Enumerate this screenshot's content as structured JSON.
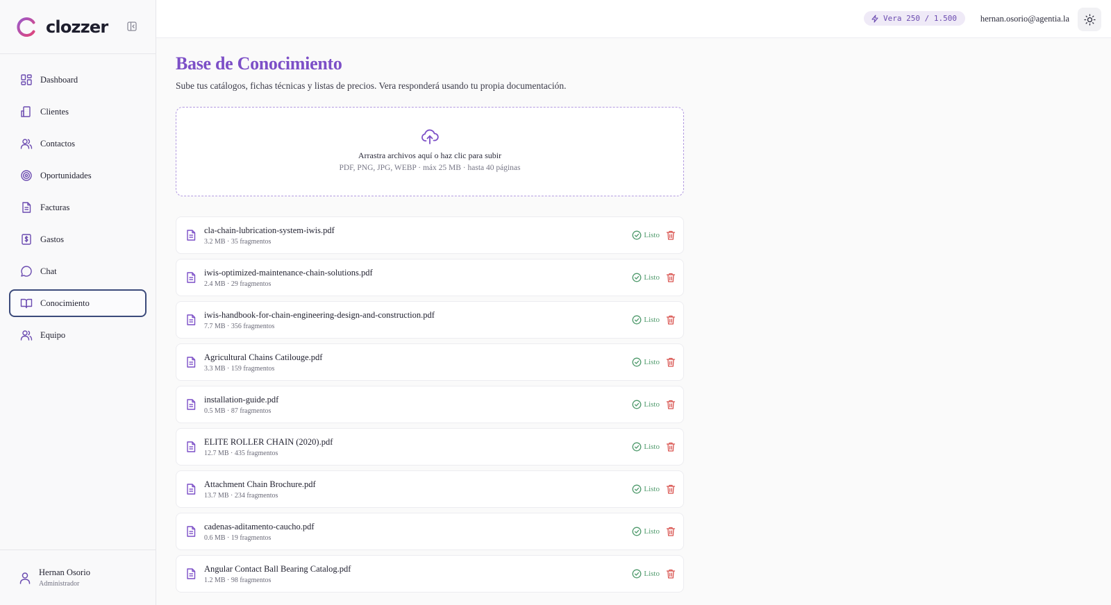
{
  "brand": {
    "name": "clozzer",
    "accent": "#7c4fc7"
  },
  "sidebar": {
    "items": [
      {
        "label": "Dashboard",
        "icon": "grid-icon"
      },
      {
        "label": "Clientes",
        "icon": "building-icon"
      },
      {
        "label": "Contactos",
        "icon": "users-icon"
      },
      {
        "label": "Oportunidades",
        "icon": "target-icon"
      },
      {
        "label": "Facturas",
        "icon": "document-icon"
      },
      {
        "label": "Gastos",
        "icon": "receipt-icon"
      },
      {
        "label": "Chat",
        "icon": "chat-bubble-icon"
      },
      {
        "label": "Conocimiento",
        "icon": "book-icon",
        "active": true
      },
      {
        "label": "Equipo",
        "icon": "team-icon"
      }
    ],
    "user": {
      "name": "Hernan Osorio",
      "role": "Administrador"
    }
  },
  "topbar": {
    "vera_label": "Vera 250 / 1.500",
    "email": "hernan.osorio@agentia.la"
  },
  "main": {
    "title": "Base de Conocimiento",
    "subtitle": "Sube tus catálogos, fichas técnicas y listas de precios. Vera responderá usando tu propia documentación.",
    "dropzone": {
      "main": "Arrastra archivos aquí o haz clic para subir",
      "sub": "PDF, PNG, JPG, WEBP · máx 25 MB · hasta 40 páginas"
    },
    "status_label": "Listo",
    "files": [
      {
        "name": "cla-chain-lubrication-system-iwis.pdf",
        "meta": "3.2 MB · 35 fragmentos"
      },
      {
        "name": "iwis-optimized-maintenance-chain-solutions.pdf",
        "meta": "2.4 MB · 29 fragmentos"
      },
      {
        "name": "iwis-handbook-for-chain-engineering-design-and-construction.pdf",
        "meta": "7.7 MB · 356 fragmentos"
      },
      {
        "name": "Agricultural Chains Catilouge.pdf",
        "meta": "3.3 MB · 159 fragmentos"
      },
      {
        "name": "installation-guide.pdf",
        "meta": "0.5 MB · 87 fragmentos"
      },
      {
        "name": "ELITE ROLLER CHAIN (2020).pdf",
        "meta": "12.7 MB · 435 fragmentos"
      },
      {
        "name": "Attachment Chain Brochure.pdf",
        "meta": "13.7 MB · 234 fragmentos"
      },
      {
        "name": "cadenas-aditamento-caucho.pdf",
        "meta": "0.6 MB · 19 fragmentos"
      },
      {
        "name": "Angular Contact Ball Bearing Catalog.pdf",
        "meta": "1.2 MB · 98 fragmentos"
      }
    ]
  }
}
